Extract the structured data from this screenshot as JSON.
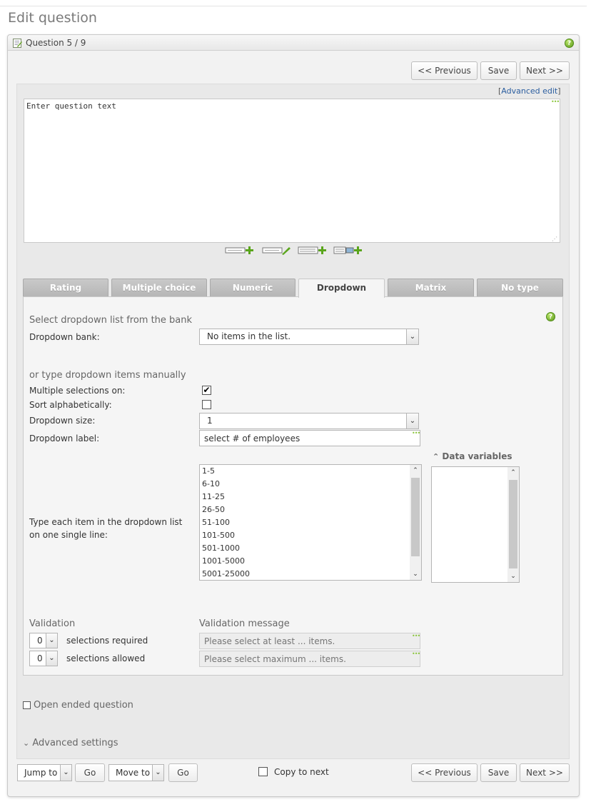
{
  "page": {
    "title": "Edit question"
  },
  "panel": {
    "header": "Question 5 / 9"
  },
  "nav": {
    "previous": "<< Previous",
    "save": "Save",
    "next": "Next >>"
  },
  "editor": {
    "advanced_edit_prefix": "[",
    "advanced_edit_link": "Advanced edit",
    "advanced_edit_suffix": "]",
    "question_text": "Enter question text"
  },
  "tabs": [
    {
      "label": "Rating"
    },
    {
      "label": "Multiple choice"
    },
    {
      "label": "Numeric"
    },
    {
      "label": "Dropdown",
      "active": true
    },
    {
      "label": "Matrix"
    },
    {
      "label": "No type"
    }
  ],
  "dropdown": {
    "bank_section": "Select dropdown list from the bank",
    "bank_label": "Dropdown bank:",
    "bank_value": "No items in the list.",
    "manual_section": "or type dropdown items manually",
    "multiple_label": "Multiple selections on:",
    "multiple_checked": true,
    "sort_label": "Sort alphabetically:",
    "sort_checked": false,
    "size_label": "Dropdown size:",
    "size_value": "1",
    "dropdown_label_label": "Dropdown label:",
    "dropdown_label_value": "select # of employees",
    "items_label": "Type each item in the dropdown list on one single line:",
    "items": [
      "1-5",
      "6-10",
      "11-25",
      "26-50",
      "51-100",
      "101-500",
      "501-1000",
      "1001-5000",
      "5001-25000"
    ],
    "data_variables_label": "Data variables"
  },
  "validation": {
    "title": "Validation",
    "message_title": "Validation message",
    "required_value": "0",
    "required_label": "selections required",
    "required_placeholder": "Please select at least ... items.",
    "allowed_value": "0",
    "allowed_label": "selections allowed",
    "allowed_placeholder": "Please select maximum ... items."
  },
  "options": {
    "open_ended": "Open ended question",
    "advanced_settings": "Advanced settings"
  },
  "footer": {
    "jump_to": "Jump to",
    "go": "Go",
    "move_to": "Move to",
    "copy_to_next": "Copy to next"
  },
  "colors": {
    "accent_link": "#2a5d9f",
    "help_green": "#5e9a1c",
    "tab_inactive": "#b6b6b6"
  }
}
